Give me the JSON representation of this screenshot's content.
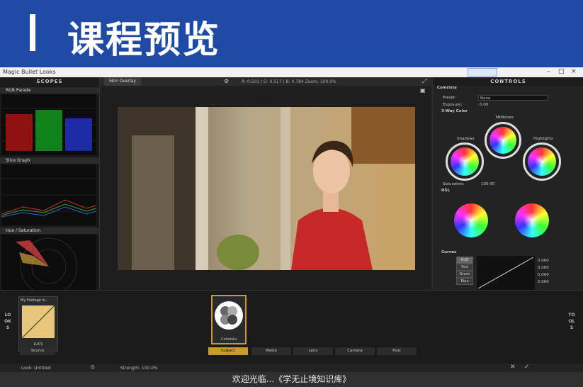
{
  "banner": {
    "title": "课程预览"
  },
  "window": {
    "title": "Magic Bullet Looks",
    "minimize": "–",
    "maximize": "□",
    "close": "×"
  },
  "scopes": {
    "header": "SCOPES",
    "sections": [
      "RGB Parade",
      "Slice Graph",
      "Hue / Saturation"
    ]
  },
  "viewer": {
    "tab": "Skin Overlay",
    "readout": "R: 0.501 | G: 0.517 | B: 0.784   Zoom: 100.0%"
  },
  "controls": {
    "header": "CONTROLS",
    "tool": "Colorista",
    "preset_label": "Preset:",
    "preset_value": "None",
    "exposure_label": "Exposure:",
    "exposure_value": "0.00",
    "threeway_label": "3-Way Color",
    "midtones": "Midtones",
    "shadows": "Shadows",
    "highlights": "Highlights",
    "saturation_label": "Saturation:",
    "saturation_value": "100.00",
    "hsl_label": "HSL",
    "curves_label": "Curves",
    "curve_channels": [
      "RGB",
      "Red",
      "Green",
      "Blue"
    ],
    "curve_values": [
      "0.000",
      "0.000",
      "0.000",
      "0.000"
    ]
  },
  "bottom": {
    "looks_label": "LOOKS",
    "tools_label": "TOOLS",
    "look_card": "My Footage lo...",
    "look_sub": "LUCS",
    "source_tab": "Source",
    "tool_card": "Colorista",
    "tabs": [
      "Subject",
      "Matte",
      "Lens",
      "Camera",
      "Post"
    ]
  },
  "status": {
    "look": "Look: Untitled",
    "strength": "Strength: 100.0%"
  },
  "footer": {
    "text": "欢迎光临...《学无止境知识库》"
  },
  "colors": {
    "banner": "#1f4aa5",
    "accent": "#c99a2e"
  }
}
